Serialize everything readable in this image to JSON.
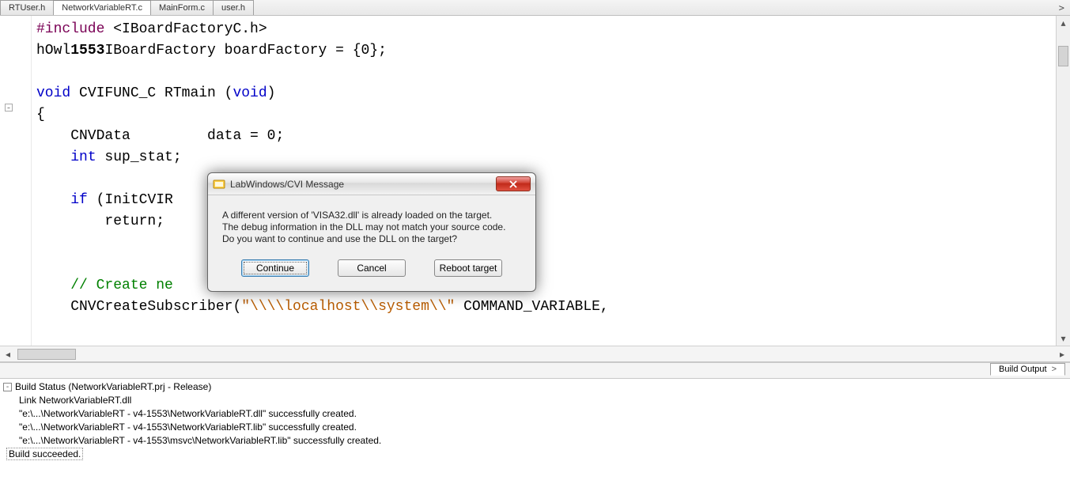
{
  "tabs": [
    {
      "label": "RTUser.h",
      "active": false
    },
    {
      "label": "NetworkVariableRT.c",
      "active": true
    },
    {
      "label": "MainForm.c",
      "active": false
    },
    {
      "label": "user.h",
      "active": false
    }
  ],
  "code": {
    "line1_pre": "#include ",
    "line1_inc": "<IBoardFactoryC.h>",
    "line2_a": "hOwl",
    "line2_b": "1553",
    "line2_c": "IBoardFactory boardFactory = {",
    "line2_d": "0",
    "line2_e": "};",
    "line3_void": "void",
    "line3_mid": " CVIFUNC_C RTmain (",
    "line3_void2": "void",
    "line3_end": ")",
    "line4": "{",
    "line5_a": "    CNVData         data = ",
    "line5_b": "0",
    "line5_c": ";",
    "line6_a": "    ",
    "line6_b": "int",
    "line6_c": " sup_stat;",
    "line7_a": "    ",
    "line7_b": "if",
    "line7_c": " (InitCVIR",
    "line8": "        return;    ",
    "line9_a": "    ",
    "line9_cmt": "// Create ne",
    "line10_a": "    CNVCreateSubscriber(",
    "line10_str": "\"\\\\\\\\localhost\\\\system\\\\\"",
    "line10_b": " COMMAND_VARIABLE,"
  },
  "dialog": {
    "title": "LabWindows/CVI Message",
    "msg_line1": "A different version of 'VISA32.dll' is already loaded on the target.",
    "msg_line2": "The debug information in the DLL may not match your source code.",
    "msg_line3": "Do you want to continue and use the DLL on the target?",
    "btn_continue": "Continue",
    "btn_cancel": "Cancel",
    "btn_reboot": "Reboot target"
  },
  "output": {
    "tab_label": "Build Output",
    "root": "Build Status (NetworkVariableRT.prj - Release)",
    "lines": [
      "Link NetworkVariableRT.dll",
      "\"e:\\...\\NetworkVariableRT - v4-1553\\NetworkVariableRT.dll\" successfully created.",
      "\"e:\\...\\NetworkVariableRT - v4-1553\\NetworkVariableRT.lib\" successfully created.",
      "\"e:\\...\\NetworkVariableRT - v4-1553\\msvc\\NetworkVariableRT.lib\" successfully created."
    ],
    "final": "Build succeeded."
  }
}
